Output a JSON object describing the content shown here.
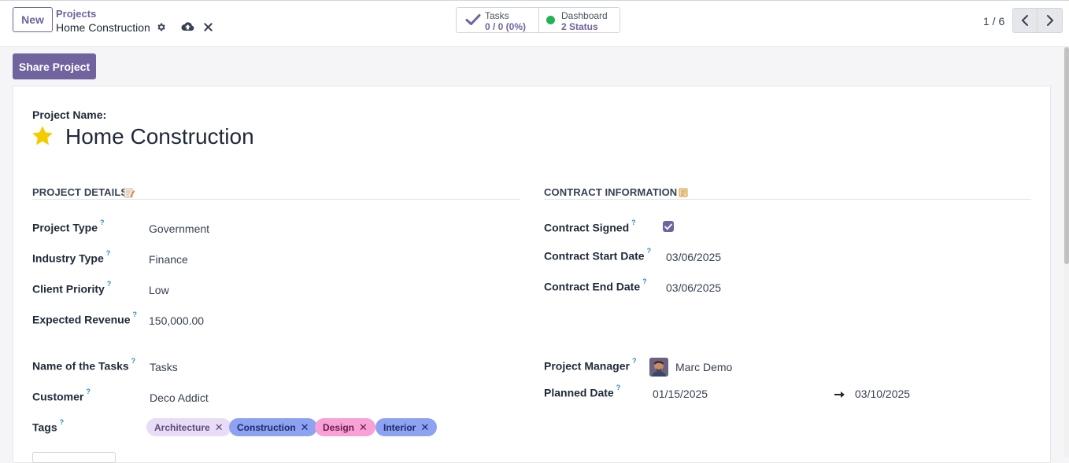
{
  "control_panel": {
    "new_label": "New",
    "breadcrumb_parent": "Projects",
    "breadcrumb_current": "Home Construction",
    "icons": {
      "settings": "gear-icon",
      "save": "cloud-upload-icon",
      "discard": "close-icon"
    }
  },
  "smart_buttons": {
    "tasks": {
      "title": "Tasks",
      "value": "0 / 0 (0%)",
      "icon": "check-icon"
    },
    "dashboard": {
      "title": "Dashboard",
      "value": "2 Status",
      "status_color": "#21b354"
    }
  },
  "pager": {
    "text": "1 / 6"
  },
  "actions": {
    "share_label": "Share Project"
  },
  "form": {
    "name_label": "Project Name:",
    "name": "Home Construction",
    "favorite_color": "#f3cc00",
    "sections": {
      "project_details": "PROJECT DETAILS",
      "contract_information": "CONTRACT INFORMATION"
    },
    "fields": {
      "project_type": {
        "label": "Project Type",
        "value": "Government"
      },
      "industry_type": {
        "label": "Industry Type",
        "value": "Finance"
      },
      "client_priority": {
        "label": "Client Priority",
        "value": "Low"
      },
      "expected_revenue": {
        "label": "Expected Revenue",
        "value": "150,000.00"
      },
      "name_of_tasks": {
        "label": "Name of the Tasks",
        "value": "Tasks"
      },
      "customer": {
        "label": "Customer",
        "value": "Deco Addict"
      },
      "tags": {
        "label": "Tags",
        "items": [
          {
            "name": "Architecture",
            "bg": "#e9dcf7",
            "fg": "#5b4a7a"
          },
          {
            "name": "Construction",
            "bg": "#8da2f0",
            "fg": "#1e2a6b"
          },
          {
            "name": "Design",
            "bg": "#f7a1d6",
            "fg": "#6b1a4e"
          },
          {
            "name": "Interior",
            "bg": "#8da2f0",
            "fg": "#1e2a6b"
          }
        ]
      },
      "contract_signed": {
        "label": "Contract Signed",
        "checked": true
      },
      "contract_start_date": {
        "label": "Contract Start Date",
        "value": "03/06/2025"
      },
      "contract_end_date": {
        "label": "Contract End Date",
        "value": "03/06/2025"
      },
      "project_manager": {
        "label": "Project Manager",
        "value": "Marc Demo"
      },
      "planned_date": {
        "label": "Planned Date",
        "start": "01/15/2025",
        "end": "03/10/2025"
      }
    },
    "help_marker": "?"
  },
  "colors": {
    "brand": "#71639e",
    "help": "#2a8fb8"
  }
}
